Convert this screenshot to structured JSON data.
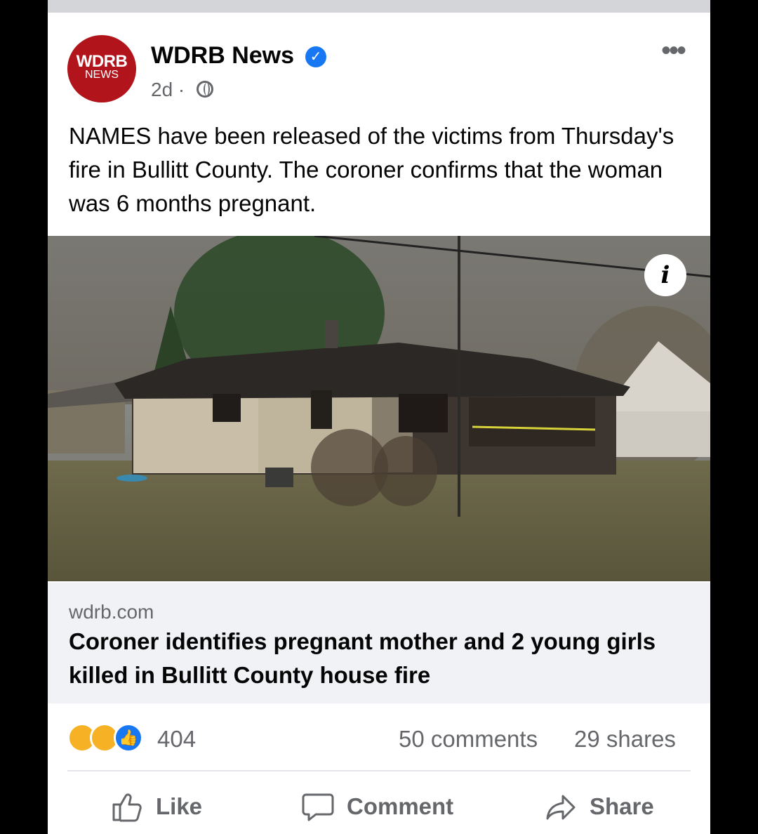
{
  "post": {
    "avatar": {
      "line1": "WDRB",
      "line2": "NEWS"
    },
    "page_name": "WDRB News",
    "verified_icon": "verified-check-icon",
    "time": "2d ·",
    "audience_icon": "globe-icon",
    "more_icon": "more-options-icon",
    "caption": "NAMES have been released of the victims from Thursday's fire in Bullitt County. The coroner confirms that the woman was 6 months pregnant."
  },
  "link_preview": {
    "info_icon": "info-icon",
    "domain": "wdrb.com",
    "title": "Coroner identifies pregnant mother and 2 young girls killed in Bullitt County house fire"
  },
  "stats": {
    "reaction_icons": [
      "sad-reaction-icon",
      "care-reaction-icon",
      "like-reaction-icon"
    ],
    "reaction_count": "404",
    "comments": "50 comments",
    "shares": "29 shares"
  },
  "actions": {
    "like": "Like",
    "comment": "Comment",
    "share": "Share"
  },
  "colors": {
    "brand_red": "#b1141b",
    "facebook_blue": "#1877f2"
  }
}
